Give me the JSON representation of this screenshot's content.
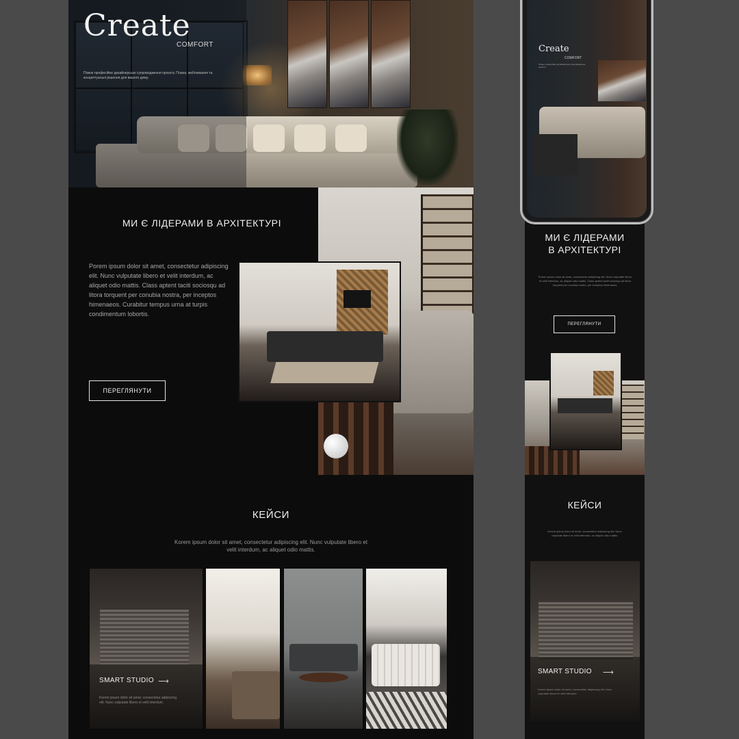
{
  "desktop": {
    "hero": {
      "logo": "Create",
      "logo_sub": "COMFORT",
      "tagline": "Повне професійне дизайнерське супроводження проєкту. Плани, меблювання та концептуальні рішення для вашого дому."
    },
    "about": {
      "title": "МИ Є ЛІДЕРАМИ В АРХІТЕКТУРІ",
      "text": "Porem ipsum dolor sit amet, consectetur adipiscing elit. Nunc vulputate libero et velit interdum, ac aliquet odio mattis. Class aptent taciti sociosqu ad litora torquent per conubia nostra, per inceptos himenaeos. Curabitur tempus urna at turpis condimentum lobortis.",
      "button": "ПЕРЕГЛЯНУТИ"
    },
    "cases": {
      "title": "КЕЙСИ",
      "text": "Korem ipsum dolor sit amet, consectetur adipiscing elit. Nunc vulputate libero et velit interdum, ac aliquet odio mattis.",
      "featured": {
        "title": "SMART STUDIO",
        "arrow": "⟶",
        "text": "Korem ipsum dolor sit amet, consectetur adipiscing elit. Nunc vulputate libero et velit interdum."
      }
    }
  },
  "mobile": {
    "hero": {
      "logo": "Create",
      "logo_sub": "COMFORT",
      "tagline": "Повне професійне дизайнерське супроводження проєкту."
    },
    "about": {
      "title_line1": "МИ Є ЛІДЕРАМИ",
      "title_line2": "В АРХІТЕКТУРІ",
      "text": "Porem ipsum dolor sit amet, consectetur adipiscing elit. Nunc vulputate libero et velit interdum, ac aliquet odio mattis. Class aptent taciti sociosqu ad litora torquent per conubia nostra, per inceptos himenaeos.",
      "button": "ПЕРЕГЛЯНУТИ"
    },
    "cases": {
      "title": "КЕЙСИ",
      "text": "Korem ipsum dolor sit amet, consectetur adipiscing elit. Nunc vulputate libero et velit interdum, ac aliquet odio mattis.",
      "featured": {
        "title": "SMART STUDIO",
        "arrow": "⟶",
        "text": "Korem ipsum dolor sit amet, consectetur adipiscing elit. Nunc vulputate libero et velit interdum."
      }
    }
  },
  "colors": {
    "page_background": "#4a4a4a",
    "section_background": "#0c0c0c",
    "text_primary": "#f0f0f0",
    "text_muted": "#9a9a9a"
  }
}
